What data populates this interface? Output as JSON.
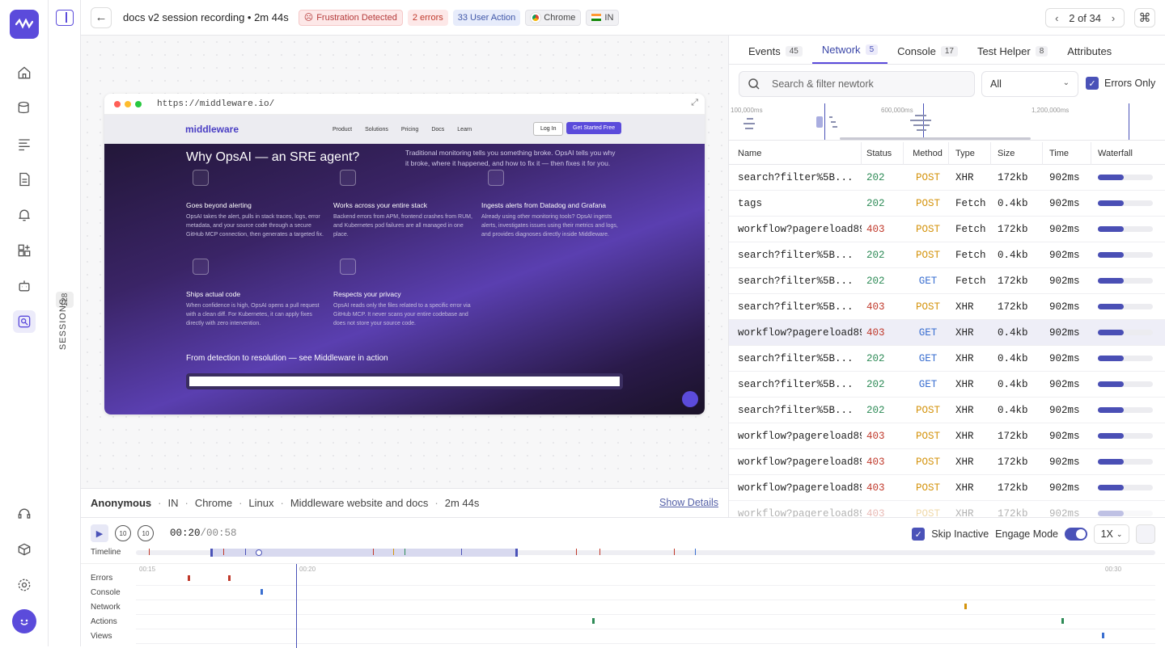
{
  "header": {
    "title": "docs v2 session recording • 2m 44s",
    "badges": {
      "frustration": "Frustration Detected",
      "errors": "2 errors",
      "actions": "33 User Action",
      "browser": "Chrome",
      "country": "IN"
    },
    "pager": "2 of 34"
  },
  "sessions_bar": {
    "label": "SESSIONS",
    "count": "128"
  },
  "recording": {
    "url": "https://middleware.io/",
    "site": {
      "logo": "middleware",
      "nav": [
        "Product",
        "Solutions",
        "Pricing",
        "Docs",
        "Learn"
      ],
      "login": "Log In",
      "cta": "Get Started Free",
      "heading": "Why OpsAI — an SRE agent?",
      "intro": "Traditional monitoring tells you something broke. OpsAI tells you why it broke, where it happened, and how to fix it — then fixes it for you.",
      "features": [
        {
          "title": "Goes beyond alerting",
          "text": "OpsAI takes the alert, pulls in stack traces, logs, error metadata, and your source code through a secure GitHub MCP connection, then generates a targeted fix."
        },
        {
          "title": "Works across your entire stack",
          "text": "Backend errors from APM, frontend crashes from RUM, and Kubernetes pod failures are all managed in one place."
        },
        {
          "title": "Ingests alerts from Datadog and Grafana",
          "text": "Already using other monitoring tools? OpsAI ingests alerts, investigates issues using their metrics and logs, and provides diagnoses directly inside Middleware."
        },
        {
          "title": "Ships actual code",
          "text": "When confidence is high, OpsAI opens a pull request with a clean diff. For Kubernetes, it can apply fixes directly with zero intervention."
        },
        {
          "title": "Respects your privacy",
          "text": "OpsAI reads only the files related to a specific error via GitHub MCP. It never scans your entire codebase and does not store your source code."
        }
      ],
      "footer_heading": "From detection to resolution — see Middleware in action"
    }
  },
  "meta": {
    "user": "Anonymous",
    "country": "IN",
    "browser": "Chrome",
    "os": "Linux",
    "app": "Middleware website and docs",
    "duration": "2m 44s",
    "show_details": "Show Details"
  },
  "tabs": [
    {
      "label": "Events",
      "count": "45"
    },
    {
      "label": "Network",
      "count": "5"
    },
    {
      "label": "Console",
      "count": "17"
    },
    {
      "label": "Test Helper",
      "count": "8"
    },
    {
      "label": "Attributes",
      "count": ""
    }
  ],
  "filter": {
    "search_placeholder": "Search & filter newtork",
    "select_value": "All",
    "errors_only": "Errors Only"
  },
  "minimap_labels": [
    "100,000ms",
    "600,000ms",
    "1,200,000ms"
  ],
  "network": {
    "columns": [
      "Name",
      "Status",
      "Method",
      "Type",
      "Size",
      "Time",
      "Waterfall"
    ],
    "rows": [
      {
        "name": "search?filter%5B...",
        "status": "202",
        "method": "POST",
        "type": "XHR",
        "size": "172kb",
        "time": "902ms"
      },
      {
        "name": "tags",
        "status": "202",
        "method": "POST",
        "type": "Fetch",
        "size": "0.4kb",
        "time": "902ms"
      },
      {
        "name": "workflow?pagereload89",
        "status": "403",
        "method": "POST",
        "type": "Fetch",
        "size": "172kb",
        "time": "902ms"
      },
      {
        "name": "search?filter%5B...",
        "status": "202",
        "method": "POST",
        "type": "Fetch",
        "size": "0.4kb",
        "time": "902ms"
      },
      {
        "name": "search?filter%5B...",
        "status": "202",
        "method": "GET",
        "type": "Fetch",
        "size": "172kb",
        "time": "902ms"
      },
      {
        "name": "search?filter%5B...",
        "status": "403",
        "method": "POST",
        "type": "XHR",
        "size": "172kb",
        "time": "902ms"
      },
      {
        "name": "workflow?pagereload89",
        "status": "403",
        "method": "GET",
        "type": "XHR",
        "size": "0.4kb",
        "time": "902ms"
      },
      {
        "name": "search?filter%5B...",
        "status": "202",
        "method": "GET",
        "type": "XHR",
        "size": "0.4kb",
        "time": "902ms"
      },
      {
        "name": "search?filter%5B...",
        "status": "202",
        "method": "GET",
        "type": "XHR",
        "size": "0.4kb",
        "time": "902ms"
      },
      {
        "name": "search?filter%5B...",
        "status": "202",
        "method": "POST",
        "type": "XHR",
        "size": "0.4kb",
        "time": "902ms"
      },
      {
        "name": "workflow?pagereload89",
        "status": "403",
        "method": "POST",
        "type": "XHR",
        "size": "172kb",
        "time": "902ms"
      },
      {
        "name": "workflow?pagereload89",
        "status": "403",
        "method": "POST",
        "type": "XHR",
        "size": "172kb",
        "time": "902ms"
      },
      {
        "name": "workflow?pagereload89",
        "status": "403",
        "method": "POST",
        "type": "XHR",
        "size": "172kb",
        "time": "902ms"
      },
      {
        "name": "workflow?pagereload89",
        "status": "403",
        "method": "POST",
        "type": "XHR",
        "size": "172kb",
        "time": "902ms"
      }
    ]
  },
  "player": {
    "current": "00:20",
    "total": "/00:58",
    "skip_inactive": "Skip Inactive",
    "engage_mode": "Engage Mode",
    "speed": "1X",
    "timeline_label": "Timeline",
    "scale": [
      "00:15",
      "00:20",
      "00:30"
    ],
    "lanes": [
      "Errors",
      "Console",
      "Network",
      "Actions",
      "Views"
    ]
  },
  "colors": {
    "accent": "#5b4bdb",
    "error": "#c0392b",
    "success": "#2e8b57",
    "warn": "#d4930c",
    "get": "#3a6fd0"
  }
}
